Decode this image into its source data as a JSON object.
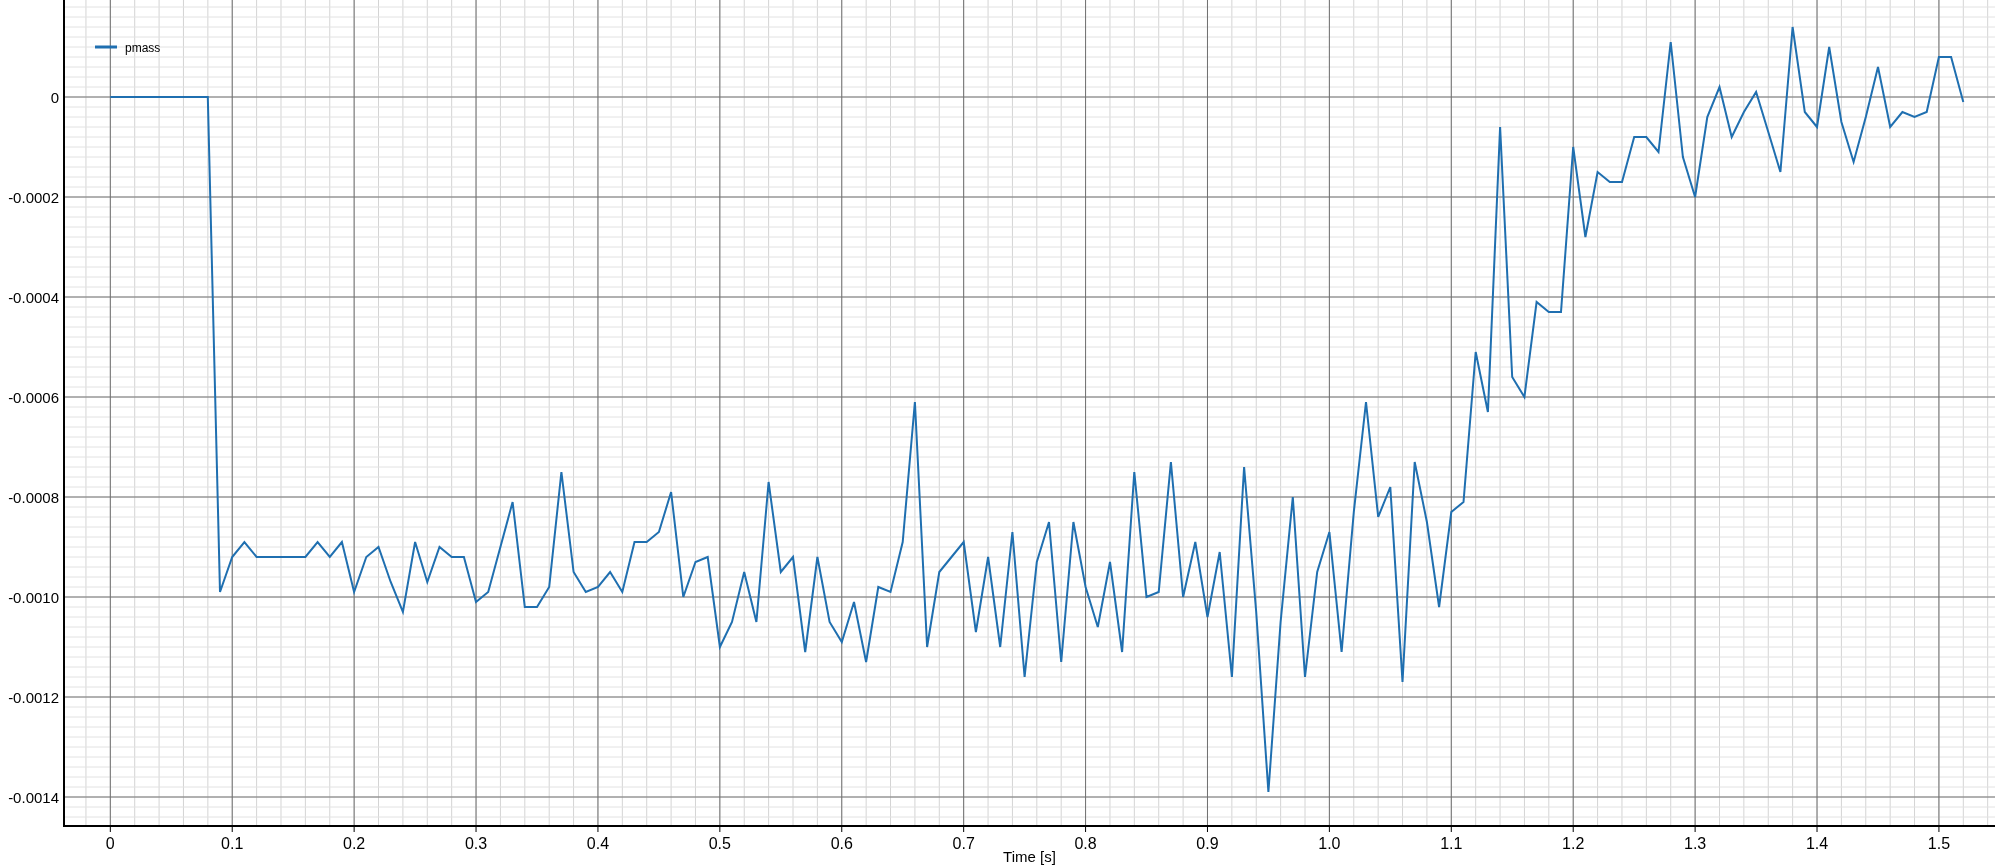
{
  "chart_data": {
    "type": "line",
    "xlabel": "Time [s]",
    "grid": true,
    "x": [
      0,
      0.01,
      0.02,
      0.03,
      0.04,
      0.05,
      0.06,
      0.07,
      0.08,
      0.09,
      0.1,
      0.11,
      0.12,
      0.13,
      0.14,
      0.15,
      0.16,
      0.17,
      0.18,
      0.19,
      0.2,
      0.21,
      0.22,
      0.23,
      0.24,
      0.25,
      0.26,
      0.27,
      0.28,
      0.29,
      0.3,
      0.31,
      0.32,
      0.33,
      0.34,
      0.35,
      0.36,
      0.37,
      0.38,
      0.39,
      0.4,
      0.41,
      0.42,
      0.43,
      0.44,
      0.45,
      0.46,
      0.47,
      0.48,
      0.49,
      0.5,
      0.51,
      0.52,
      0.53,
      0.54,
      0.55,
      0.56,
      0.57,
      0.58,
      0.59,
      0.6,
      0.61,
      0.62,
      0.63,
      0.64,
      0.65,
      0.66,
      0.67,
      0.68,
      0.69,
      0.7,
      0.71,
      0.72,
      0.73,
      0.74,
      0.75,
      0.76,
      0.77,
      0.78,
      0.79,
      0.8,
      0.81,
      0.82,
      0.83,
      0.84,
      0.85,
      0.86,
      0.87,
      0.88,
      0.89,
      0.9,
      0.91,
      0.92,
      0.93,
      0.94,
      0.95,
      0.96,
      0.97,
      0.98,
      0.99,
      1,
      1.01,
      1.02,
      1.03,
      1.04,
      1.05,
      1.06,
      1.07,
      1.08,
      1.09,
      1.1,
      1.11,
      1.12,
      1.13,
      1.14,
      1.15,
      1.16,
      1.17,
      1.18,
      1.19,
      1.2,
      1.21,
      1.22,
      1.23,
      1.24,
      1.25,
      1.26,
      1.27,
      1.28,
      1.29,
      1.3,
      1.31,
      1.32,
      1.33,
      1.34,
      1.35,
      1.36,
      1.37,
      1.38,
      1.39,
      1.4,
      1.41,
      1.42,
      1.43,
      1.44,
      1.45,
      1.46,
      1.47,
      1.48,
      1.49,
      1.5,
      1.51,
      1.52
    ],
    "series": [
      {
        "name": "pmass",
        "color": "#1f6fb0",
        "values": [
          0,
          0,
          0,
          0,
          0,
          0,
          0,
          0,
          0,
          -0.00099,
          -0.00092,
          -0.00089,
          -0.00092,
          -0.00092,
          -0.00092,
          -0.00092,
          -0.00092,
          -0.00089,
          -0.00092,
          -0.00089,
          -0.00099,
          -0.00092,
          -0.0009,
          -0.00097,
          -0.00103,
          -0.00089,
          -0.00097,
          -0.0009,
          -0.00092,
          -0.00092,
          -0.00101,
          -0.00099,
          -0.0009,
          -0.00081,
          -0.00102,
          -0.00102,
          -0.00098,
          -0.00075,
          -0.00095,
          -0.00099,
          -0.00098,
          -0.00095,
          -0.00099,
          -0.00089,
          -0.00089,
          -0.00087,
          -0.00079,
          -0.001,
          -0.00093,
          -0.00092,
          -0.0011,
          -0.00105,
          -0.00095,
          -0.00105,
          -0.00077,
          -0.00095,
          -0.00092,
          -0.00111,
          -0.00092,
          -0.00105,
          -0.00109,
          -0.00101,
          -0.00113,
          -0.00098,
          -0.00099,
          -0.00089,
          -0.00061,
          -0.0011,
          -0.00095,
          -0.00092,
          -0.00089,
          -0.00107,
          -0.00092,
          -0.0011,
          -0.00087,
          -0.00116,
          -0.00093,
          -0.00085,
          -0.00113,
          -0.00085,
          -0.00098,
          -0.00106,
          -0.00093,
          -0.00111,
          -0.00075,
          -0.001,
          -0.00099,
          -0.00073,
          -0.001,
          -0.00089,
          -0.00104,
          -0.00091,
          -0.00116,
          -0.00074,
          -0.00103,
          -0.00139,
          -0.00105,
          -0.0008,
          -0.00116,
          -0.00095,
          -0.00087,
          -0.00111,
          -0.00083,
          -0.00061,
          -0.00084,
          -0.00078,
          -0.00117,
          -0.00073,
          -0.00085,
          -0.00102,
          -0.00083,
          -0.00081,
          -0.00051,
          -0.00063,
          -6e-05,
          -0.00056,
          -0.0006,
          -0.00041,
          -0.00043,
          -0.00043,
          -0.0001,
          -0.00028,
          -0.00015,
          -0.00017,
          -0.00017,
          -8e-05,
          -8e-05,
          -0.00011,
          0.00011,
          -0.00012,
          -0.0002,
          -4e-05,
          2e-05,
          -8e-05,
          -3e-05,
          1e-05,
          -7e-05,
          -0.00015,
          0.00014,
          -3e-05,
          -6e-05,
          0.0001,
          -5e-05,
          -0.00013,
          -4e-05,
          6e-05,
          -6e-05,
          -3e-05,
          -4e-05,
          -3e-05,
          8e-05,
          8e-05,
          -1e-05
        ]
      }
    ],
    "xlim": [
      -0.038,
      1.546
    ],
    "ylim": [
      -0.001458,
      0.000194
    ],
    "xticks": [
      0,
      0.1,
      0.2,
      0.3,
      0.4,
      0.5,
      0.6,
      0.7,
      0.8,
      0.9,
      {
        "value": 1,
        "label": "1.0"
      },
      1.1,
      1.2,
      1.3,
      1.4,
      1.5
    ],
    "yticks": [
      0,
      {
        "value": -0.0002,
        "label": "-0.0002"
      },
      {
        "value": -0.0004,
        "label": "-0.0004"
      },
      {
        "value": -0.0006,
        "label": "-0.0006"
      },
      {
        "value": -0.0008,
        "label": "-0.0008"
      },
      {
        "value": -0.001,
        "label": "-0.0010"
      },
      {
        "value": -0.0012,
        "label": "-0.0012"
      },
      {
        "value": -0.0014,
        "label": "-0.0014"
      }
    ]
  }
}
